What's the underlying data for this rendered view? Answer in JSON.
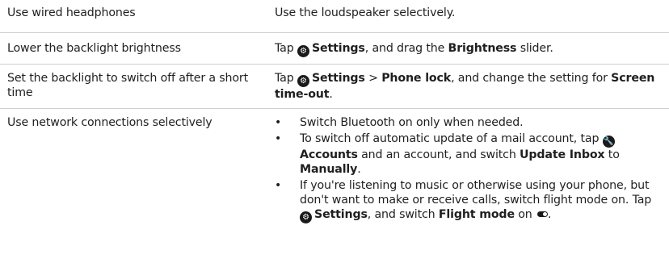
{
  "rows": [
    {
      "tip": "Use wired headphones",
      "how": "Use the loudspeaker selectively."
    },
    {
      "tip": "Lower the backlight brightness",
      "how": {
        "pre": "Tap ",
        "icon": "settings-icon",
        "settings": "Settings",
        "mid": ", and drag the ",
        "brightness": "Brightness",
        "post": " slider."
      }
    },
    {
      "tip": "Set the backlight to switch off after a short time",
      "how": {
        "pre": "Tap ",
        "icon": "settings-icon",
        "settings": "Settings",
        "sep": " > ",
        "phone_lock": "Phone lock",
        "mid": ", and change the setting for ",
        "timeout": "Screen time-out",
        "post": "."
      }
    },
    {
      "tip": "Use network connections selectively",
      "bullets": [
        {
          "text": "Switch Bluetooth on only when needed."
        },
        {
          "pre": "To switch off automatic update of a mail account, tap ",
          "icon": "accounts-icon",
          "accounts": "Accounts",
          "mid": " and an account, and switch ",
          "update_inbox": "Update Inbox",
          "to": " to ",
          "manually": "Manually",
          "post": "."
        },
        {
          "pre": "If you're listening to music or otherwise using your phone, but don't want to make or receive calls, switch flight mode on. Tap ",
          "icon": "settings-icon",
          "settings": "Settings",
          "mid": ", and switch ",
          "flight_mode": "Flight mode",
          "on": " on ",
          "toggle_icon": "toggle-on-icon",
          "post": "."
        }
      ]
    }
  ]
}
